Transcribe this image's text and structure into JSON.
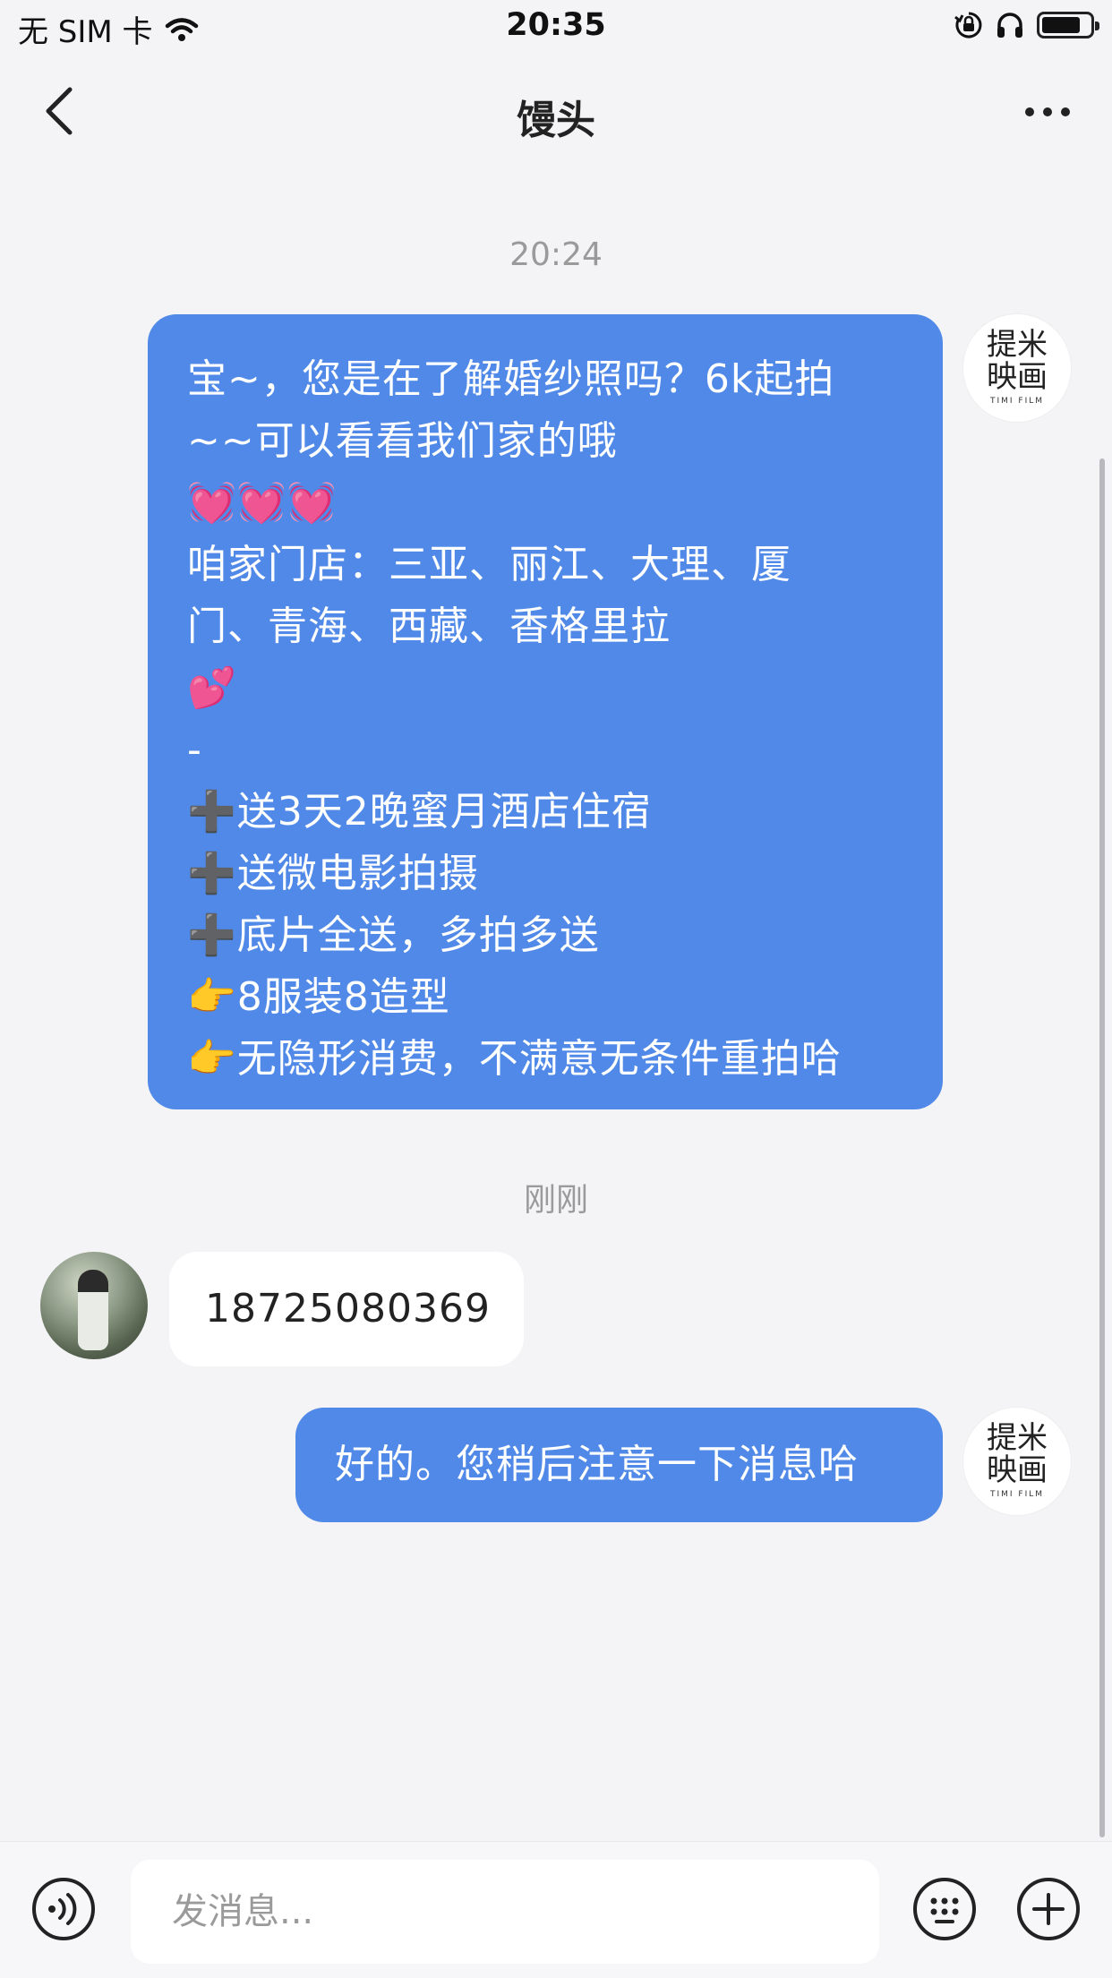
{
  "status_bar": {
    "carrier": "无 SIM 卡",
    "time": "20:35",
    "icons": [
      "wifi-icon",
      "orientation-lock-icon",
      "headphones-icon",
      "battery-icon"
    ]
  },
  "nav": {
    "title": "馒头",
    "back_icon": "chevron-left-icon",
    "more_icon": "more-dots-icon"
  },
  "messages": [
    {
      "timestamp": "20:24",
      "side": "outgoing",
      "text": "宝~，您是在了解婚纱照吗？6k起拍\n~~可以看看我们家的哦\n💓💓💓\n咱家门店：三亚、丽江、大理、厦\n门、青海、西藏、香格里拉\n💕\n-\n➕送3天2晚蜜月酒店住宿\n➕送微电影拍摄\n➕底片全送，多拍多送\n👉8服装8造型\n👉无隐形消费，不满意无条件重拍哈",
      "avatar_line1": "提米",
      "avatar_line2": "映画",
      "avatar_line3": "TIMI FILM"
    },
    {
      "timestamp": "刚刚",
      "side": "incoming",
      "text": "18725080369"
    },
    {
      "side": "outgoing",
      "text": "好的。您稍后注意一下消息哈",
      "avatar_line1": "提米",
      "avatar_line2": "映画",
      "avatar_line3": "TIMI FILM"
    }
  ],
  "input": {
    "placeholder": "发消息...",
    "value": "",
    "voice_icon": "voice-icon",
    "emoji_icon": "emoji-icon",
    "plus_icon": "plus-icon"
  },
  "colors": {
    "outgoing_bubble": "#5089e8",
    "incoming_bubble": "#ffffff",
    "background": "#f4f4f6",
    "timestamp_text": "#9a9a9a"
  }
}
